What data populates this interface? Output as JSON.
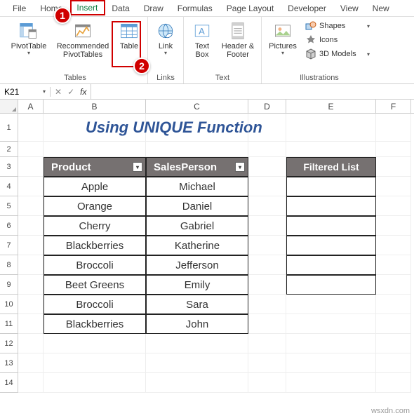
{
  "menu": {
    "items": [
      "File",
      "Home",
      "Insert",
      "Data",
      "Draw",
      "Formulas",
      "Page Layout",
      "Developer",
      "View",
      "New"
    ],
    "active_index": 2
  },
  "ribbon": {
    "tables": {
      "label": "Tables",
      "pivot": "PivotTable",
      "recommended": "Recommended PivotTables",
      "table": "Table"
    },
    "links": {
      "label": "Links",
      "link": "Link"
    },
    "text": {
      "label": "Text",
      "textbox": "Text Box",
      "headerfooter": "Header & Footer"
    },
    "illustrations": {
      "label": "Illustrations",
      "pictures": "Pictures",
      "shapes": "Shapes",
      "icons": "Icons",
      "models": "3D Models"
    }
  },
  "namebox": "K21",
  "fx_label": "fx",
  "columns": [
    "A",
    "B",
    "C",
    "D",
    "E",
    "F"
  ],
  "sheet": {
    "title": "Using UNIQUE Function",
    "headers": {
      "product": "Product",
      "sales": "SalesPerson"
    },
    "data": [
      {
        "product": "Apple",
        "sales": "Michael"
      },
      {
        "product": "Orange",
        "sales": "Daniel"
      },
      {
        "product": "Cherry",
        "sales": "Gabriel"
      },
      {
        "product": "Blackberries",
        "sales": "Katherine"
      },
      {
        "product": "Broccoli",
        "sales": "Jefferson"
      },
      {
        "product": "Beet Greens",
        "sales": "Emily"
      },
      {
        "product": "Broccoli",
        "sales": "Sara"
      },
      {
        "product": "Blackberries",
        "sales": "John"
      }
    ],
    "filtered": "Filtered List"
  },
  "callouts": {
    "one": "1",
    "two": "2"
  },
  "watermark": "wsxdn.com"
}
